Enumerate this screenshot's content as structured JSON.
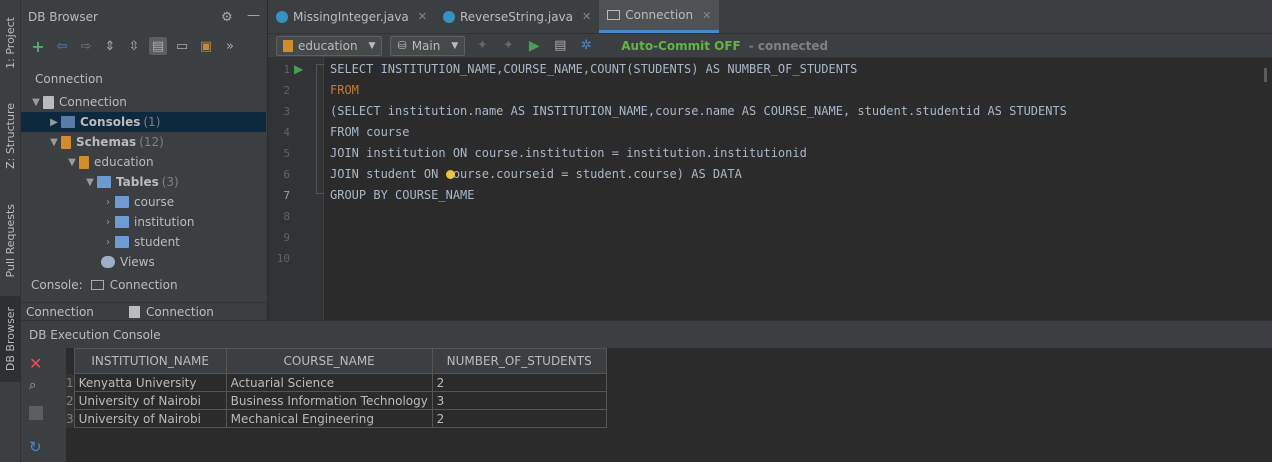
{
  "left_strip": {
    "tabs": [
      "1: Project",
      "Z: Structure",
      "Pull Requests",
      "DB Browser"
    ]
  },
  "db_browser": {
    "title": "DB Browser",
    "tree_caption": "Connection",
    "tree": [
      {
        "label": "Connection",
        "count": "",
        "bold": false
      },
      {
        "label": "Consoles",
        "count": "(1)",
        "bold": true
      },
      {
        "label": "Schemas",
        "count": "(12)",
        "bold": true
      },
      {
        "label": "education",
        "count": "",
        "bold": false
      },
      {
        "label": "Tables",
        "count": "(3)",
        "bold": true
      },
      {
        "label": "course",
        "count": "",
        "bold": false
      },
      {
        "label": "institution",
        "count": "",
        "bold": false
      },
      {
        "label": "student",
        "count": "",
        "bold": false
      },
      {
        "label": "Views",
        "count": "",
        "bold": false
      }
    ],
    "console_label": "Console:",
    "console_value": "Connection",
    "bottom_tabs": [
      "Connection",
      "Connection"
    ]
  },
  "editor": {
    "tabs": [
      {
        "label": "MissingInteger.java"
      },
      {
        "label": "ReverseString.java"
      },
      {
        "label": "Connection"
      }
    ],
    "schema_combo": "education",
    "session_combo": "Main",
    "autocommit": "Auto-Commit OFF",
    "status": "- connected",
    "line_numbers": [
      "1",
      "2",
      "3",
      "4",
      "5",
      "6",
      "7",
      "8",
      "9",
      "10"
    ],
    "code_lines": [
      "SELECT INSTITUTION_NAME,COURSE_NAME,COUNT(STUDENTS) AS NUMBER_OF_STUDENTS",
      "FROM",
      "(SELECT institution.name AS INSTITUTION_NAME,course.name AS COURSE_NAME, student.studentid AS STUDENTS",
      "FROM course",
      "JOIN institution ON course.institution = institution.institutionid",
      "JOIN student ON course.courseid = student.course) AS DATA",
      "GROUP BY COURSE_NAME",
      "",
      "",
      ""
    ]
  },
  "results": {
    "title": "DB Execution Console",
    "columns": [
      "INSTITUTION_NAME",
      "COURSE_NAME",
      "NUMBER_OF_STUDENTS"
    ],
    "rows": [
      [
        "1",
        "Kenyatta University",
        "Actuarial Science",
        "2"
      ],
      [
        "2",
        "University of Nairobi",
        "Business Information Technology",
        "3"
      ],
      [
        "3",
        "University of Nairobi",
        "Mechanical Engineering",
        "2"
      ]
    ]
  }
}
